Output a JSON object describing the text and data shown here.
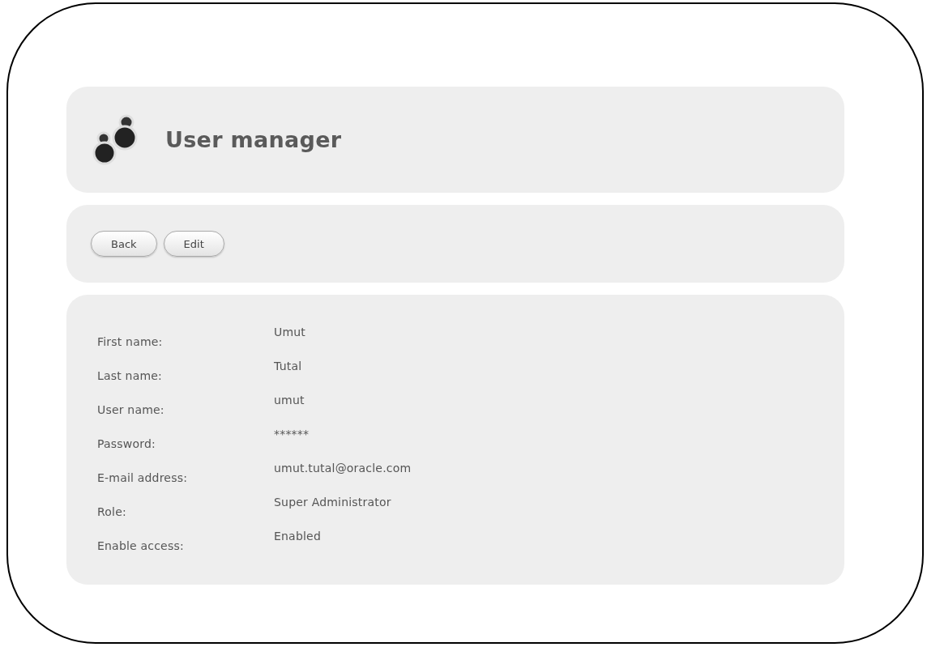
{
  "header": {
    "title": "User manager"
  },
  "toolbar": {
    "buttons": [
      "Back",
      "Edit"
    ]
  },
  "details": [
    {
      "label": "First name:",
      "value": "Umut"
    },
    {
      "label": "Last name:",
      "value": "Tutal"
    },
    {
      "label": "User name:",
      "value": "umut"
    },
    {
      "label": "Password:",
      "value": "******"
    },
    {
      "label": "E-mail address:",
      "value": "umut.tutal@oracle.com"
    },
    {
      "label": "Role:",
      "value": "Super Administrator"
    },
    {
      "label": "Enable access:",
      "value": "Enabled"
    }
  ]
}
